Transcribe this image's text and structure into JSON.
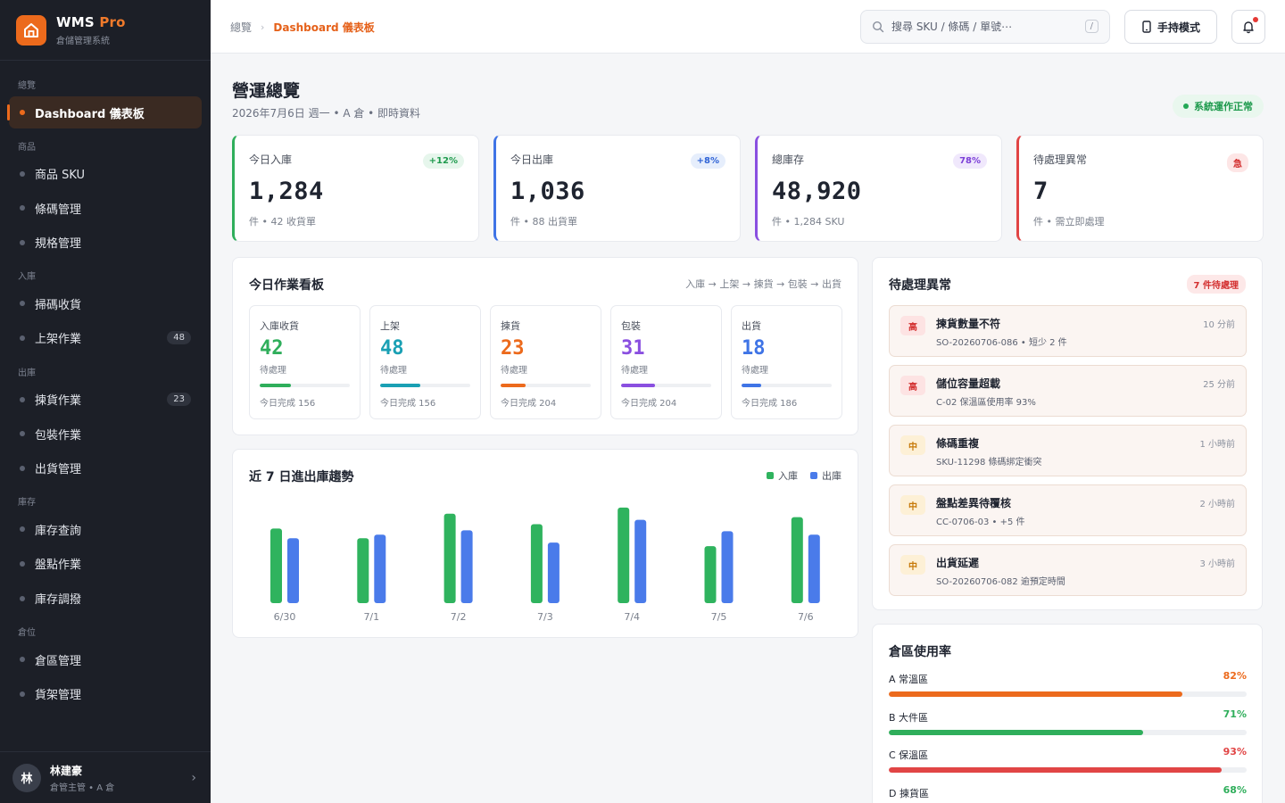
{
  "brand": {
    "name": "WMS",
    "name_suffix": "Pro",
    "subtitle": "倉儲管理系統"
  },
  "sidebar": {
    "groups": [
      {
        "label": "總覽",
        "items": [
          {
            "label": "Dashboard 儀表板",
            "active": true
          }
        ]
      },
      {
        "label": "商品",
        "items": [
          {
            "label": "商品 SKU"
          },
          {
            "label": "條碼管理"
          },
          {
            "label": "規格管理"
          }
        ]
      },
      {
        "label": "入庫",
        "items": [
          {
            "label": "掃碼收貨"
          },
          {
            "label": "上架作業",
            "badge": "48"
          }
        ]
      },
      {
        "label": "出庫",
        "items": [
          {
            "label": "揀貨作業",
            "badge": "23"
          },
          {
            "label": "包裝作業"
          },
          {
            "label": "出貨管理"
          }
        ]
      },
      {
        "label": "庫存",
        "items": [
          {
            "label": "庫存查詢"
          },
          {
            "label": "盤點作業"
          },
          {
            "label": "庫存調撥"
          }
        ]
      },
      {
        "label": "倉位",
        "items": [
          {
            "label": "倉區管理"
          },
          {
            "label": "貨架管理"
          }
        ]
      }
    ]
  },
  "user": {
    "initial": "林",
    "name": "林建豪",
    "role": "倉管主管 • A 倉"
  },
  "topbar": {
    "breadcrumb_root": "總覽",
    "breadcrumb_current": "Dashboard 儀表板",
    "search_placeholder": "搜尋 SKU / 條碼 / 單號⋯",
    "search_shortcut": "/",
    "handheld_label": "手持模式"
  },
  "page": {
    "title": "營運總覽",
    "subtitle": "2026年7月6日 週一 • A 倉 • 即時資料",
    "status": "系統運作正常"
  },
  "kpis": [
    {
      "label": "今日入庫",
      "tag": "+12%",
      "value": "1,284",
      "foot": "件 • 42 收貨單",
      "color": "#2fae5b",
      "tag_bg": "#e6f6ec",
      "tag_fg": "#1e9a4d"
    },
    {
      "label": "今日出庫",
      "tag": "+8%",
      "value": "1,036",
      "foot": "件 • 88 出貨單",
      "color": "#3f74e6",
      "tag_bg": "#e6eefc",
      "tag_fg": "#2f63d6"
    },
    {
      "label": "總庫存",
      "tag": "78%",
      "value": "48,920",
      "foot": "件 • 1,284 SKU",
      "color": "#8a4fe0",
      "tag_bg": "#f0e8fc",
      "tag_fg": "#7c3fd8"
    },
    {
      "label": "待處理異常",
      "tag": "急",
      "value": "7",
      "foot": "件 • 需立即處理",
      "color": "#e14545",
      "tag_bg": "#fde6e6",
      "tag_fg": "#d32f2f"
    }
  ],
  "board": {
    "title": "今日作業看板",
    "flow": "入庫 → 上架 → 揀貨 → 包裝 → 出貨",
    "stages": [
      {
        "name": "入庫收貨",
        "value": "42",
        "pending": "待處理",
        "done": "今日完成 156",
        "progress": 0.35,
        "color": "#2fae5b"
      },
      {
        "name": "上架",
        "value": "48",
        "pending": "待處理",
        "done": "今日完成 156",
        "progress": 0.45,
        "color": "#1aa0b4"
      },
      {
        "name": "揀貨",
        "value": "23",
        "pending": "待處理",
        "done": "今日完成 204",
        "progress": 0.28,
        "color": "#ec6a1c"
      },
      {
        "name": "包裝",
        "value": "31",
        "pending": "待處理",
        "done": "今日完成 204",
        "progress": 0.38,
        "color": "#8a4fe0"
      },
      {
        "name": "出貨",
        "value": "18",
        "pending": "待處理",
        "done": "今日完成 186",
        "progress": 0.22,
        "color": "#3f74e6"
      }
    ]
  },
  "trend": {
    "title": "近 7 日進出庫趨勢",
    "legend_in": "入庫",
    "legend_out": "出庫"
  },
  "chart_data": {
    "type": "bar",
    "categories": [
      "6/30",
      "7/1",
      "7/2",
      "7/3",
      "7/4",
      "7/5",
      "7/6"
    ],
    "series": [
      {
        "name": "入庫",
        "values": [
          85,
          74,
          102,
          90,
          109,
          65,
          98
        ],
        "color": "#2fb35e"
      },
      {
        "name": "出庫",
        "values": [
          74,
          78,
          83,
          69,
          95,
          82,
          78
        ],
        "color": "#4a7bea"
      }
    ],
    "ylim": [
      0,
      120
    ],
    "grid": false,
    "legend": "top-right"
  },
  "exceptions": {
    "title": "待處理異常",
    "pending": "7 件待處理",
    "items": [
      {
        "level": "高",
        "title": "揀貨數量不符",
        "desc": "SO-20260706-086 • 短少 2 件",
        "time": "10 分前",
        "lvl_bg": "#fde3e3",
        "lvl_fg": "#d32f2f"
      },
      {
        "level": "高",
        "title": "儲位容量超載",
        "desc": "C-02 保溫區使用率 93%",
        "time": "25 分前",
        "lvl_bg": "#fde3e3",
        "lvl_fg": "#d32f2f"
      },
      {
        "level": "中",
        "title": "條碼重複",
        "desc": "SKU-11298 條碼綁定衝突",
        "time": "1 小時前",
        "lvl_bg": "#fdf0d6",
        "lvl_fg": "#c77a0a"
      },
      {
        "level": "中",
        "title": "盤點差異待覆核",
        "desc": "CC-0706-03 • +5 件",
        "time": "2 小時前",
        "lvl_bg": "#fdf0d6",
        "lvl_fg": "#c77a0a"
      },
      {
        "level": "中",
        "title": "出貨延遲",
        "desc": "SO-20260706-082 逾預定時間",
        "time": "3 小時前",
        "lvl_bg": "#fdf0d6",
        "lvl_fg": "#c77a0a"
      }
    ]
  },
  "zones": {
    "title": "倉區使用率",
    "items": [
      {
        "label": "A 常溫區",
        "pct": "82%",
        "value": 0.82,
        "color": "#ec6a1c"
      },
      {
        "label": "B 大件區",
        "pct": "71%",
        "value": 0.71,
        "color": "#2fae5b"
      },
      {
        "label": "C 保溫區",
        "pct": "93%",
        "value": 0.93,
        "color": "#e14545"
      },
      {
        "label": "D 揀貨區",
        "pct": "68%",
        "value": 0.68,
        "color": "#2fae5b"
      }
    ]
  }
}
